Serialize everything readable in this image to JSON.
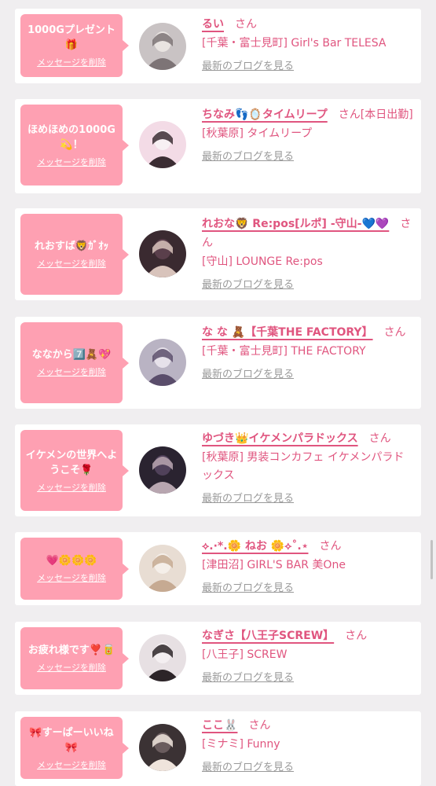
{
  "messages": [
    {
      "message": "1000Gプレゼント🎁",
      "delete_label": "メッセージを削除",
      "name": "るい",
      "honorific": "さん",
      "shop": "[千葉・富士見町] Girl's Bar TELESA",
      "blog_link": "最新のブログを見る",
      "avatar_icon": "profile-photo"
    },
    {
      "message": "ほめほめの1000G💫！",
      "delete_label": "メッセージを削除",
      "name": "ちなみ👣🪞タイムリープ",
      "honorific": "さん[本日出勤]",
      "shop": "[秋葉原] タイムリープ",
      "blog_link": "最新のブログを見る",
      "avatar_icon": "profile-photo"
    },
    {
      "message": "れおすば🦁ｶﾞｵｯ",
      "delete_label": "メッセージを削除",
      "name": "れおな🦁 Re:pos[ルポ] -守山-💙💜",
      "honorific": "さん",
      "shop": "[守山] LOUNGE Re:pos",
      "blog_link": "最新のブログを見る",
      "avatar_icon": "profile-photo"
    },
    {
      "message": "ななから7️⃣🧸💖",
      "delete_label": "メッセージを削除",
      "name": "な な 🧸【千葉THE FACTORY】",
      "honorific": "さん",
      "shop": "[千葉・富士見町] THE FACTORY",
      "blog_link": "最新のブログを見る",
      "avatar_icon": "profile-photo"
    },
    {
      "message": "イケメンの世界へようこそ🌹",
      "delete_label": "メッセージを削除",
      "name": "ゆづき👑イケメンパラドックス",
      "honorific": "さん",
      "shop": "[秋葉原] 男装コンカフェ イケメンパラドックス",
      "blog_link": "最新のブログを見る",
      "avatar_icon": "profile-photo"
    },
    {
      "message": "💗🌼🌼🌼",
      "delete_label": "メッセージを削除",
      "name": "⟡.·*.🌼 ねお 🌼⟡˚.⋆",
      "honorific": "さん",
      "shop": "[津田沼] GIRL'S BAR 美One",
      "blog_link": "最新のブログを見る",
      "avatar_icon": "profile-photo"
    },
    {
      "message": "お疲れ様です❣️🥫",
      "delete_label": "メッセージを削除",
      "name": "なぎさ【八王子SCREW】",
      "honorific": "さん",
      "shop": "[八王子] SCREW",
      "blog_link": "最新のブログを見る",
      "avatar_icon": "profile-photo"
    },
    {
      "message": "🎀すーぱーいいね🎀",
      "delete_label": "メッセージを削除",
      "name": "ここ🐰",
      "honorific": "さん",
      "shop": "[ミナミ] Funny",
      "blog_link": "最新のブログを見る",
      "avatar_icon": "profile-photo"
    }
  ],
  "colors": {
    "bubble": "#fea0b2",
    "name_text": "#e0557f",
    "link_gray": "#999999",
    "background": "#f0eef0"
  }
}
